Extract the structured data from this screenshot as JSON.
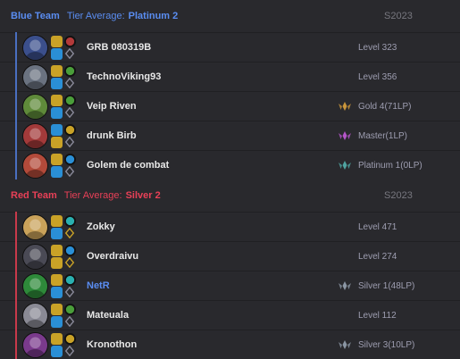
{
  "colors": {
    "blue_team": "#5a8df1",
    "red_team": "#e84057",
    "background": "#202023",
    "row_bg": "#29292d",
    "muted_text": "#9e9eb1",
    "gold": "#c9953b",
    "master": "#b455c8",
    "platinum": "#4fa3a0",
    "silver": "#8a95a3"
  },
  "blue_team": {
    "name": "Blue Team",
    "tier_label": "Tier Average:",
    "tier_value": "Platinum 2",
    "season": "S2023",
    "players": [
      {
        "name": "GRB 080319B",
        "rank": "Level 323",
        "champ_color": "#3b4f8c",
        "spells": [
          "#c9a227",
          "#2a8fd6"
        ],
        "runes": [
          "#b33a3a",
          "#8a8a9a"
        ],
        "tier_icon": "",
        "highlight": false
      },
      {
        "name": "TechnoViking93",
        "rank": "Level 356",
        "champ_color": "#6a7280",
        "spells": [
          "#c9a227",
          "#2a8fd6"
        ],
        "runes": [
          "#4a9e3a",
          "#8a8a9a"
        ],
        "tier_icon": "",
        "highlight": false
      },
      {
        "name": "Veip Riven",
        "rank": "Gold 4(71LP)",
        "champ_color": "#5f8a3a",
        "spells": [
          "#c9a227",
          "#2a8fd6"
        ],
        "runes": [
          "#4a9e3a",
          "#8a8a9a"
        ],
        "tier_icon": "gold-emblem-icon",
        "highlight": false
      },
      {
        "name": "drunk Birb",
        "rank": "Master(1LP)",
        "champ_color": "#a33a3a",
        "spells": [
          "#2a8fd6",
          "#c9a227"
        ],
        "runes": [
          "#c9a227",
          "#8a8a9a"
        ],
        "tier_icon": "master-emblem-icon",
        "highlight": false
      },
      {
        "name": "Golem de combat",
        "rank": "Platinum 1(0LP)",
        "champ_color": "#b34a3a",
        "spells": [
          "#c9a227",
          "#2a8fd6"
        ],
        "runes": [
          "#2a8fd6",
          "#8a8a9a"
        ],
        "tier_icon": "platinum-emblem-icon",
        "highlight": false
      }
    ]
  },
  "red_team": {
    "name": "Red Team",
    "tier_label": "Tier Average:",
    "tier_value": "Silver 2",
    "season": "S2023",
    "players": [
      {
        "name": "Zokky",
        "rank": "Level 471",
        "champ_color": "#c9a25a",
        "spells": [
          "#c9a227",
          "#2a8fd6"
        ],
        "runes": [
          "#2ab0b0",
          "#c9a227"
        ],
        "tier_icon": "",
        "highlight": false
      },
      {
        "name": "Overdraivu",
        "rank": "Level 274",
        "champ_color": "#4a4a55",
        "spells": [
          "#c9a227",
          "#c9a227"
        ],
        "runes": [
          "#2a8fd6",
          "#c9a227"
        ],
        "tier_icon": "",
        "highlight": false
      },
      {
        "name": "NetR",
        "rank": "Silver 1(48LP)",
        "champ_color": "#2e8a3a",
        "spells": [
          "#c9a227",
          "#2a8fd6"
        ],
        "runes": [
          "#2ab0b0",
          "#8a8a9a"
        ],
        "tier_icon": "silver-emblem-icon",
        "highlight": true
      },
      {
        "name": "Mateuala",
        "rank": "Level 112",
        "champ_color": "#8a8a95",
        "spells": [
          "#c9a227",
          "#2a8fd6"
        ],
        "runes": [
          "#4a9e3a",
          "#8a8a9a"
        ],
        "tier_icon": "",
        "highlight": false
      },
      {
        "name": "Kronothon",
        "rank": "Silver 3(10LP)",
        "champ_color": "#7a3a8c",
        "spells": [
          "#c9a227",
          "#2a8fd6"
        ],
        "runes": [
          "#c9a227",
          "#8a8a9a"
        ],
        "tier_icon": "silver-emblem-icon",
        "highlight": false
      }
    ]
  }
}
